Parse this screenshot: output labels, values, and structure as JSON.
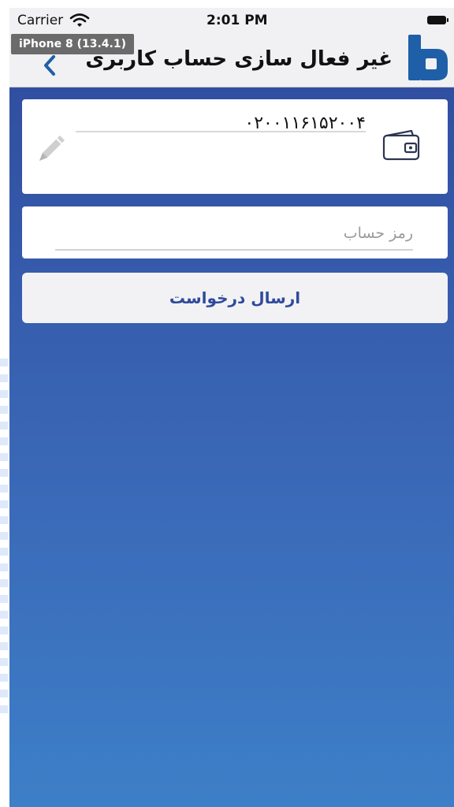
{
  "status_bar": {
    "carrier": "Carrier",
    "time": "2:01 PM"
  },
  "device_badge": "iPhone 8 (13.4.1)",
  "header": {
    "title": "غیر فعال سازی حساب کاربری"
  },
  "account": {
    "number": "۰۲۰۰۱۱۶۱۵۲۰۰۴"
  },
  "password": {
    "placeholder": "رمز حساب",
    "value": ""
  },
  "submit_label": "ارسال درخواست",
  "colors": {
    "accent": "#2f4a9c",
    "brand_logo": "#1f5fa8",
    "background_top": "#2f4a9c",
    "background_bottom": "#3d7fc8"
  },
  "icons": {
    "back": "chevron-left-icon",
    "logo": "bank-logo-icon",
    "wallet": "wallet-icon",
    "edit": "pencil-icon",
    "wifi": "wifi-icon",
    "battery": "battery-icon"
  }
}
